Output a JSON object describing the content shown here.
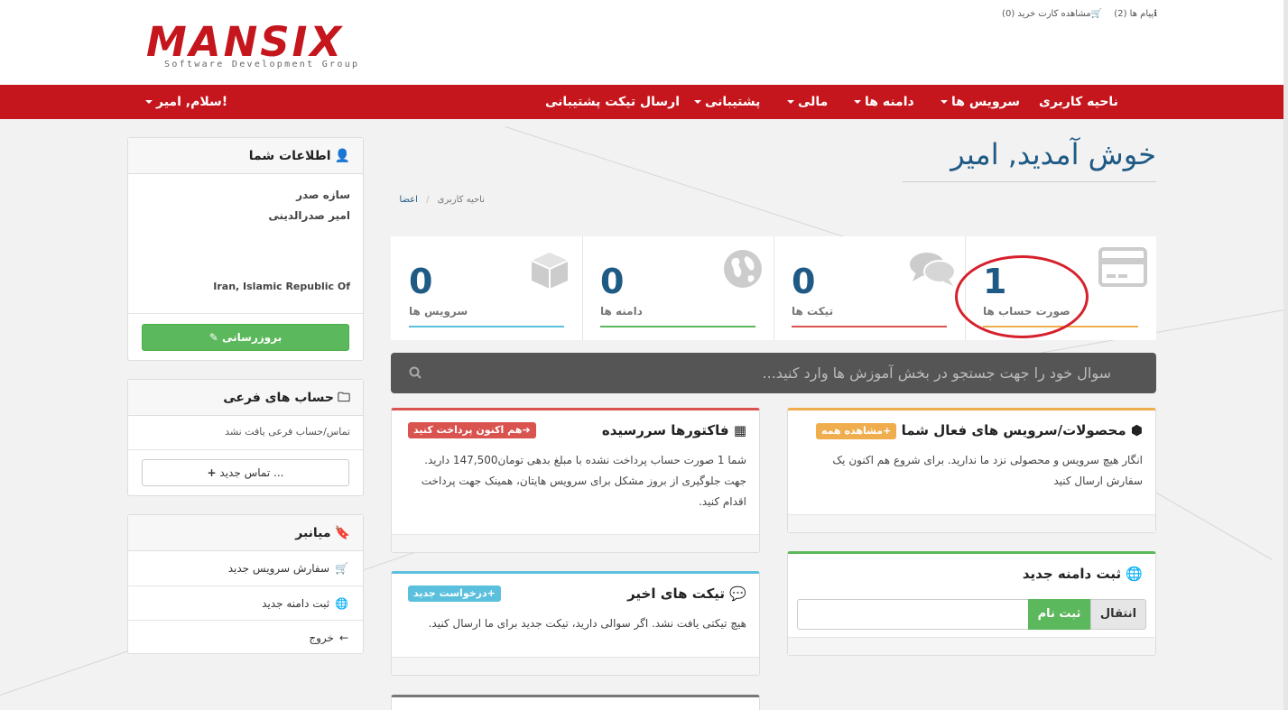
{
  "logo": {
    "main": "MANSIX",
    "sub": "Software Development Group"
  },
  "toplinks": {
    "messages": "پیام ها (2)",
    "cart": "مشاهده کارت خرید (0)"
  },
  "nav": {
    "home": "ناحیه کاربری",
    "services": "سرویس ها",
    "domains": "دامنه ها",
    "billing": "مالی",
    "support": "پشتیبانی",
    "open_ticket": "ارسال تیکت پشتیبانی",
    "greeting": "سلام, امیر!"
  },
  "page": {
    "title": "خوش آمدید, امیر",
    "breadcrumb": {
      "home": "ناحیه کاربری",
      "sep": "/",
      "current": "اعضا"
    }
  },
  "stats": [
    {
      "number": "0",
      "label": "سرویس ها",
      "color": "#5bc0de",
      "icon": "cube-icon"
    },
    {
      "number": "0",
      "label": "دامنه ها",
      "color": "#5cb85c",
      "icon": "globe-icon"
    },
    {
      "number": "0",
      "label": "تیکت ها",
      "color": "#d9534f",
      "icon": "comments-icon"
    },
    {
      "number": "1",
      "label": "صورت حساب ها",
      "color": "#f0ad4e",
      "icon": "credit-card-icon"
    }
  ],
  "search": {
    "placeholder": "سوال خود را جهت جستجو در بخش آموزش ها وارد کنید..."
  },
  "sidebar": {
    "info": {
      "title": "اطلاعات شما",
      "company": "سازه صدر",
      "name": "امیر صدرالدینی",
      "country": "Iran, Islamic Republic Of",
      "update_button": "بروزرسانی"
    },
    "contacts": {
      "title": "حساب های فرعی",
      "empty": "تماس/حساب فرعی یافت نشد",
      "new_button": "تماس جدید ..."
    },
    "shortcuts": {
      "title": "میانبر",
      "items": [
        {
          "label": "سفارش سرویس جدید",
          "icon": "cart-icon"
        },
        {
          "label": "ثبت دامنه جدید",
          "icon": "globe-icon"
        },
        {
          "label": "خروج",
          "icon": "arrow-left-icon"
        }
      ]
    }
  },
  "cards": {
    "invoices": {
      "title": "فاکتورها سررسیده",
      "badge": "هم اکنون پرداخت کنید",
      "badge_color": "#d9534f",
      "body": "شما 1 صورت حساب پرداخت نشده با مبلغ بدهی تومان147,500 دارید. جهت جلوگیری از بروز مشکل برای سرویس هایتان، همینک جهت پرداخت اقدام کنید."
    },
    "products": {
      "title": "محصولات/سرویس های فعال شما",
      "badge": "مشاهده همه",
      "badge_color": "#f0ad4e",
      "body": "انگار هیچ سرویس و محصولی نزد ما ندارید. برای شروع هم اکنون یک سفارش ارسال کنید"
    },
    "tickets": {
      "title": "تیکت های اخیر",
      "badge": "درخواست جدید",
      "badge_color": "#5bc0de",
      "body": "هیچ تیکتی یافت نشد. اگر سوالی دارید، تیکت جدید برای ما ارسال کنید."
    },
    "domain": {
      "title": "ثبت دامنه جدید",
      "register_button": "ثبت نام",
      "transfer_button": "انتقال"
    }
  }
}
